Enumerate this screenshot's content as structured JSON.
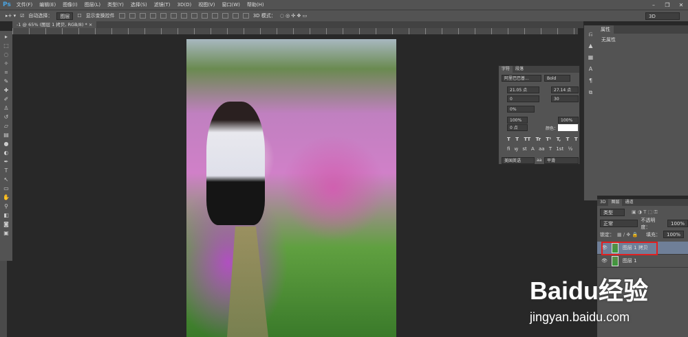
{
  "app": {
    "logo": "Ps",
    "menu": [
      "文件(F)",
      "编辑(E)",
      "图像(I)",
      "图层(L)",
      "类型(Y)",
      "选择(S)",
      "滤镜(T)",
      "3D(D)",
      "视图(V)",
      "窗口(W)",
      "帮助(H)"
    ]
  },
  "options": {
    "auto_select_label": "自动选择：",
    "auto_select_value": "图层",
    "show_transform_label": "显示变换控件",
    "mode_3d_label": "3D 模式：",
    "workspace": "3D"
  },
  "document": {
    "tab_title": "-1 @ 65% (图层 1 拷贝, RGB/8) *"
  },
  "properties": {
    "tab": "属性",
    "content": "无属性"
  },
  "character": {
    "tabs": [
      "字符",
      "段落"
    ],
    "font_family": "阿里巴巴普...",
    "font_style": "Bold",
    "font_size": "21.05 点",
    "leading": "27.14 点",
    "kerning": "0",
    "tracking": "30",
    "scale_percent": "0%",
    "vertical_scale": "100%",
    "horizontal_scale": "100%",
    "baseline_shift": "0 点",
    "color_label": "颜色：",
    "language": "美国英语",
    "aa_label": "aa",
    "antialias": "平滑",
    "color": "#ffffff",
    "style_buttons": [
      "T",
      "T",
      "TT",
      "Tr",
      "T¹",
      "T,",
      "T",
      "T"
    ],
    "ot_buttons": [
      "fi",
      "ꝡ",
      "st",
      "A",
      "aa",
      "T",
      "1st",
      "½"
    ]
  },
  "layers": {
    "tabs": [
      "3D",
      "图层",
      "通道"
    ],
    "filter": "类型",
    "blend_mode": "正常",
    "opacity_label": "不透明度：",
    "opacity": "100%",
    "lock_label": "锁定：",
    "fill_label": "填充：",
    "fill": "100%",
    "items": [
      {
        "name": "图层 1 拷贝",
        "selected": true
      },
      {
        "name": "图层 1",
        "selected": false
      }
    ]
  },
  "watermark": {
    "brand": "Baidu经验",
    "url": "jingyan.baidu.com"
  }
}
